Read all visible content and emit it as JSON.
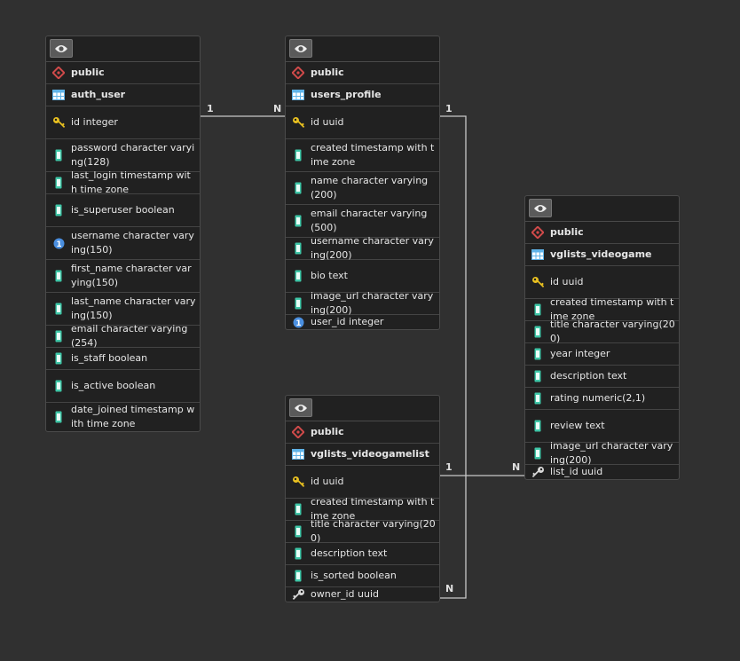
{
  "tables": [
    {
      "id": "auth_user",
      "schema": "public",
      "name": "auth_user",
      "columns": [
        {
          "label": "id integer",
          "icon": "key"
        },
        {
          "label": "password character varying(128)",
          "icon": "column"
        },
        {
          "label": "last_login timestamp with time zone",
          "icon": "column"
        },
        {
          "label": "is_superuser boolean",
          "icon": "column"
        },
        {
          "label": "username character varying(150)",
          "icon": "unique"
        },
        {
          "label": "first_name character varying(150)",
          "icon": "column"
        },
        {
          "label": "last_name character varying(150)",
          "icon": "column"
        },
        {
          "label": "email character varying(254)",
          "icon": "column"
        },
        {
          "label": "is_staff boolean",
          "icon": "column"
        },
        {
          "label": "is_active boolean",
          "icon": "column"
        },
        {
          "label": "date_joined timestamp with time zone",
          "icon": "column"
        }
      ]
    },
    {
      "id": "users_profile",
      "schema": "public",
      "name": "users_profile",
      "columns": [
        {
          "label": "id uuid",
          "icon": "key"
        },
        {
          "label": "created timestamp with time zone",
          "icon": "column"
        },
        {
          "label": "name character varying(200)",
          "icon": "column"
        },
        {
          "label": "email character varying(500)",
          "icon": "column"
        },
        {
          "label": "username character varying(200)",
          "icon": "column"
        },
        {
          "label": "bio text",
          "icon": "column"
        },
        {
          "label": "image_url character varying(200)",
          "icon": "column"
        },
        {
          "label": "user_id integer",
          "icon": "unique"
        }
      ]
    },
    {
      "id": "vglists_videogamelist",
      "schema": "public",
      "name": "vglists_videogamelist",
      "columns": [
        {
          "label": "id uuid",
          "icon": "key"
        },
        {
          "label": "created timestamp with time zone",
          "icon": "column"
        },
        {
          "label": "title character varying(200)",
          "icon": "column"
        },
        {
          "label": "description text",
          "icon": "column"
        },
        {
          "label": "is_sorted boolean",
          "icon": "column"
        },
        {
          "label": "owner_id uuid",
          "icon": "fkey"
        }
      ]
    },
    {
      "id": "vglists_videogame",
      "schema": "public",
      "name": "vglists_videogame",
      "columns": [
        {
          "label": "id uuid",
          "icon": "key"
        },
        {
          "label": "created timestamp with time zone",
          "icon": "column"
        },
        {
          "label": "title character varying(200)",
          "icon": "column"
        },
        {
          "label": "year integer",
          "icon": "column"
        },
        {
          "label": "description text",
          "icon": "column"
        },
        {
          "label": "rating numeric(2,1)",
          "icon": "column"
        },
        {
          "label": "review text",
          "icon": "column"
        },
        {
          "label": "image_url character varying(200)",
          "icon": "column"
        },
        {
          "label": "list_id uuid",
          "icon": "fkey"
        }
      ]
    }
  ],
  "relations": [
    {
      "from": "auth_user",
      "to": "users_profile",
      "from_card": "1",
      "to_card": "N"
    },
    {
      "from": "users_profile",
      "to": "vglists_videogamelist",
      "from_card": "1",
      "to_card": "N"
    },
    {
      "from": "vglists_videogamelist",
      "to": "vglists_videogame",
      "from_card": "1",
      "to_card": "N"
    }
  ],
  "colors": {
    "background": "#303030",
    "line": "#c8c8c8",
    "column_icon": "#3fc7a8",
    "key_icon": "#e8c020",
    "schema_icon": "#d04a4a",
    "table_icon": "#5fb3e8",
    "unique_icon": "#4a8fe0"
  }
}
